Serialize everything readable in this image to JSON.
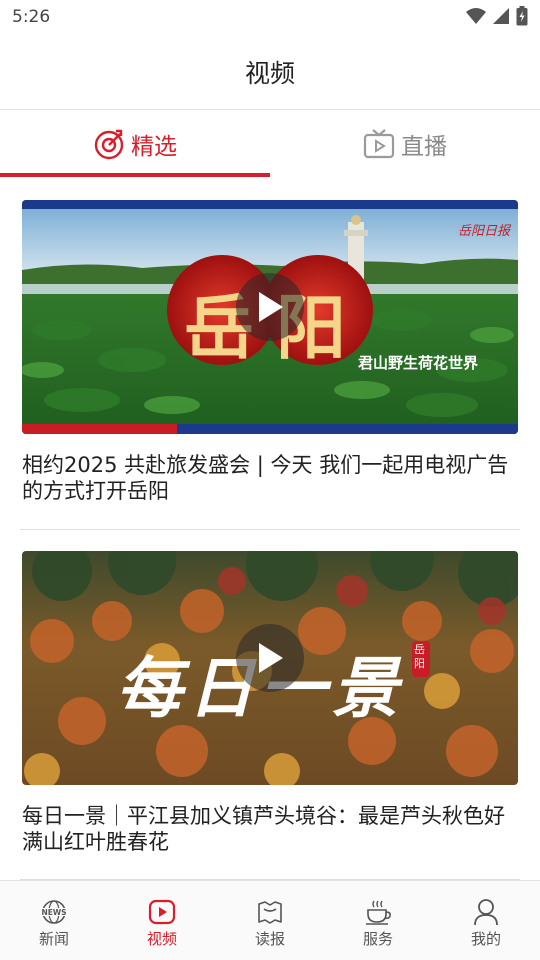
{
  "status_bar": {
    "time": "5:26"
  },
  "header": {
    "title": "视频"
  },
  "tabs": [
    {
      "label": "精选",
      "icon": "selected-target-icon",
      "active": true
    },
    {
      "label": "直播",
      "icon": "tv-play-icon",
      "active": false
    }
  ],
  "feed": [
    {
      "title": "相约2025 共赴旅发盛会 | 今天 我们一起用电视广告的方式打开岳阳",
      "thumb_overlay_big": "岳阳",
      "thumb_overlay_caption": "君山野生荷花世界",
      "thumb_logo": "岳阳日报"
    },
    {
      "title": "每日一景｜平江县加义镇芦头境谷：最是芦头秋色好 满山红叶胜春花",
      "thumb_overlay_big": "每日一景",
      "thumb_seal": "岳阳"
    }
  ],
  "bottom_nav": [
    {
      "label": "新闻",
      "icon": "globe-news-icon"
    },
    {
      "label": "视频",
      "icon": "video-play-icon",
      "active": true
    },
    {
      "label": "读报",
      "icon": "newspaper-icon"
    },
    {
      "label": "服务",
      "icon": "coffee-cup-icon"
    },
    {
      "label": "我的",
      "icon": "person-icon"
    }
  ],
  "colors": {
    "accent": "#d81e2a"
  }
}
